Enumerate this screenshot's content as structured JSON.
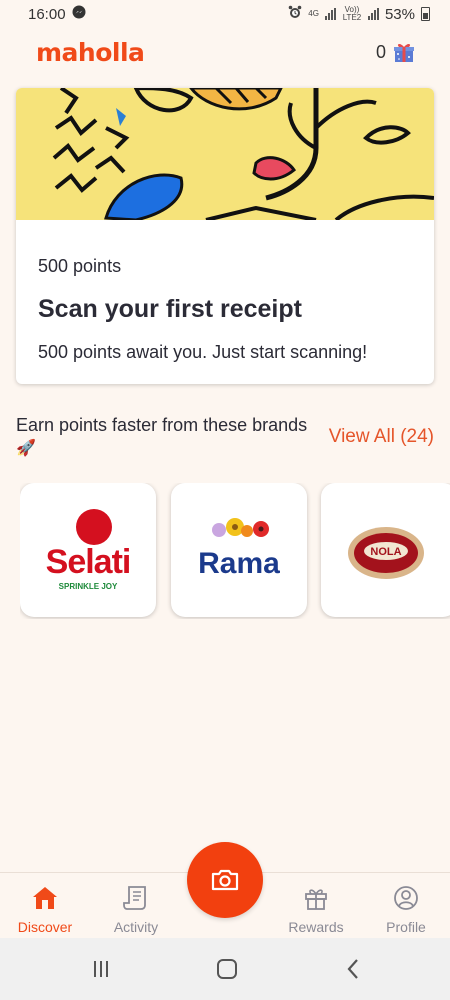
{
  "status_bar": {
    "time": "16:00",
    "network_4g": "4G",
    "network_volte": "Vo)) LTE2",
    "battery": "53%"
  },
  "header": {
    "logo": "maholla",
    "points": "0"
  },
  "promo": {
    "points_label": "500 points",
    "title": "Scan your first receipt",
    "description": "500 points await you. Just start scanning!"
  },
  "brands": {
    "title": "Earn points faster from these brands",
    "view_all": "View All (24)",
    "items": [
      {
        "name": "Selati",
        "tagline": "SPRINKLE JOY"
      },
      {
        "name": "Rama"
      },
      {
        "name": "NOLA"
      }
    ]
  },
  "bottom_nav": {
    "items": [
      {
        "label": "Discover",
        "active": true
      },
      {
        "label": "Activity"
      },
      {
        "label": "Rewards"
      },
      {
        "label": "Profile"
      }
    ]
  },
  "colors": {
    "accent": "#f04a19",
    "background": "#fdf6f0",
    "promo_art": "#f6e37a"
  }
}
